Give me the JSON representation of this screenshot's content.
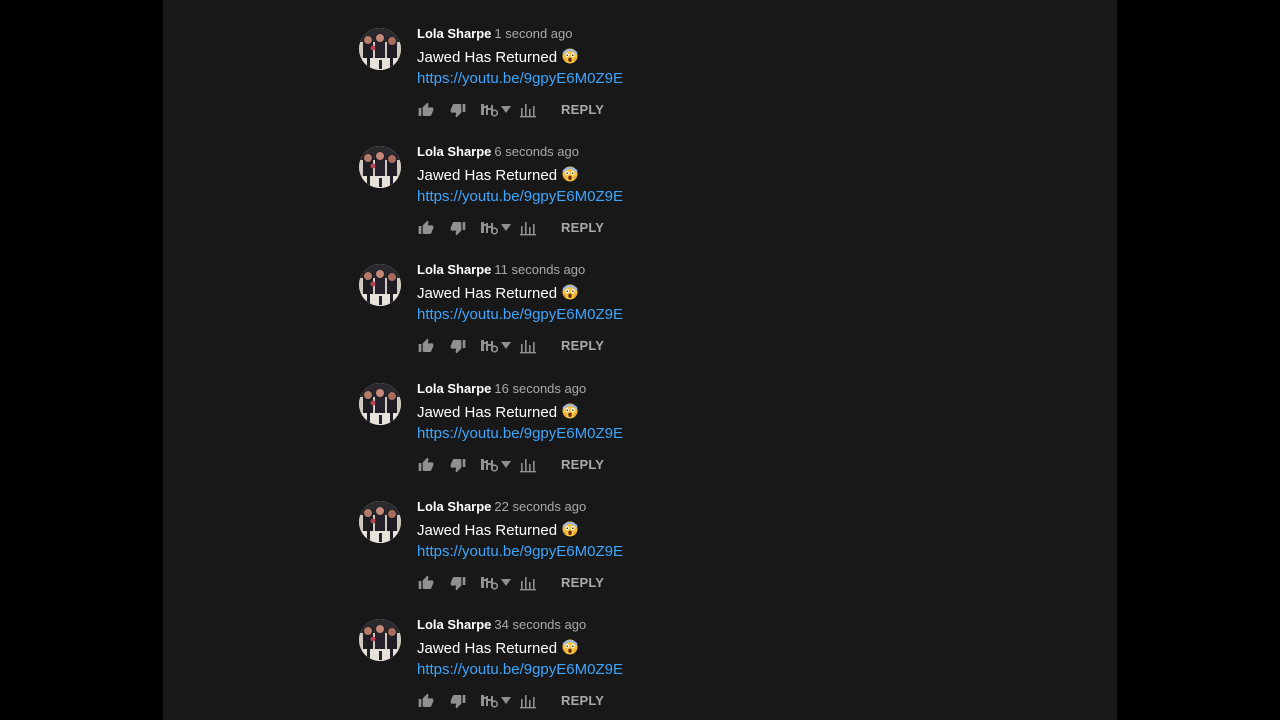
{
  "colors": {
    "panel_bg": "#181818",
    "author": "#ffffff",
    "timestamp": "#aaaaaa",
    "link": "#3ea6ff",
    "icon": "#909090"
  },
  "comments": [
    {
      "author": "Lola Sharpe",
      "time": "1 second ago",
      "text": "Jawed Has Returned",
      "emoji": "😱",
      "link": "https://youtu.be/9gpyE6M0Z9E",
      "reply_label": "REPLY"
    },
    {
      "author": "Lola Sharpe",
      "time": "6 seconds ago",
      "text": "Jawed Has Returned",
      "emoji": "😱",
      "link": "https://youtu.be/9gpyE6M0Z9E",
      "reply_label": "REPLY"
    },
    {
      "author": "Lola Sharpe",
      "time": "11 seconds ago",
      "text": "Jawed Has Returned",
      "emoji": "😱",
      "link": "https://youtu.be/9gpyE6M0Z9E",
      "reply_label": "REPLY"
    },
    {
      "author": "Lola Sharpe",
      "time": "16 seconds ago",
      "text": "Jawed Has Returned",
      "emoji": "😱",
      "link": "https://youtu.be/9gpyE6M0Z9E",
      "reply_label": "REPLY"
    },
    {
      "author": "Lola Sharpe",
      "time": "22 seconds ago",
      "text": "Jawed Has Returned",
      "emoji": "😱",
      "link": "https://youtu.be/9gpyE6M0Z9E",
      "reply_label": "REPLY"
    },
    {
      "author": "Lola Sharpe",
      "time": "34 seconds ago",
      "text": "Jawed Has Returned",
      "emoji": "😱",
      "link": "https://youtu.be/9gpyE6M0Z9E",
      "reply_label": "REPLY"
    }
  ],
  "icons": [
    "thumbs-up-icon",
    "thumbs-down-icon",
    "translate-icon",
    "dropdown-arrow-icon",
    "analytics-icon",
    "scream-emoji-icon"
  ]
}
